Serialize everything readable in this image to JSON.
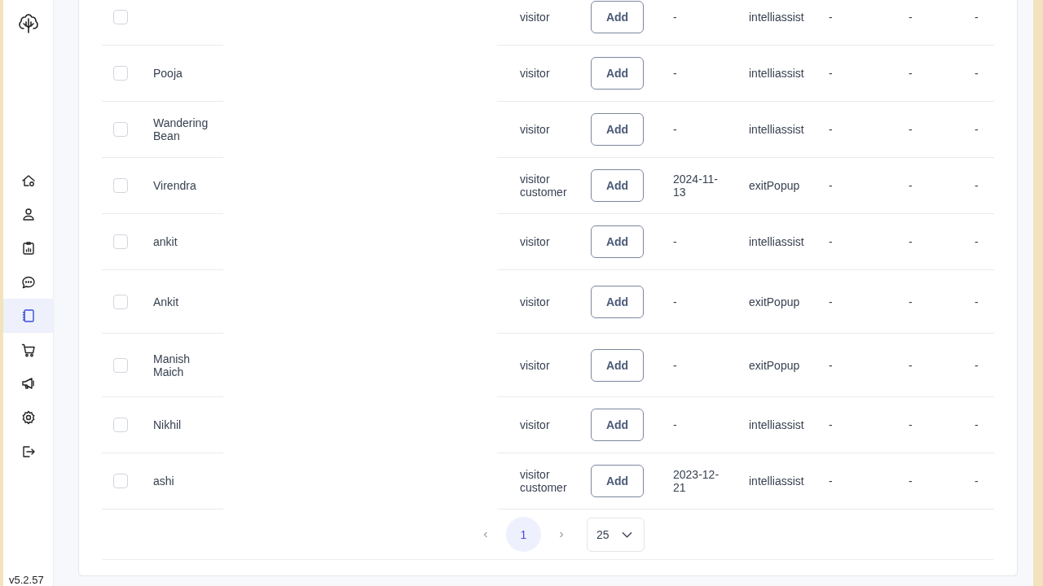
{
  "sidebar": {
    "items": [
      {
        "selected": false
      },
      {
        "selected": false
      },
      {
        "selected": false
      },
      {
        "selected": false
      },
      {
        "selected": true
      },
      {
        "selected": false
      },
      {
        "selected": false
      },
      {
        "selected": false
      },
      {
        "selected": false
      }
    ],
    "version": "v5.2.57"
  },
  "table": {
    "rows": [
      {
        "checked": false,
        "name": "",
        "types": [
          "visitor"
        ],
        "action": "Add",
        "date": "-",
        "source": "intelliassist",
        "column_7": "-",
        "column_8": "-",
        "column_9": "-"
      },
      {
        "checked": false,
        "name": "Pooja",
        "types": [
          "visitor"
        ],
        "action": "Add",
        "date": "-",
        "source": "intelliassist",
        "column_7": "-",
        "column_8": "-",
        "column_9": "-"
      },
      {
        "checked": false,
        "name": "Wandering Bean",
        "types": [
          "visitor"
        ],
        "action": "Add",
        "date": "-",
        "source": "intelliassist",
        "column_7": "-",
        "column_8": "-",
        "column_9": "-"
      },
      {
        "checked": false,
        "name": "Virendra",
        "types": [
          "visitor",
          "customer"
        ],
        "action": "Add",
        "date": "2024-11-13",
        "source": "exitPopup",
        "column_7": "-",
        "column_8": "-",
        "column_9": "-"
      },
      {
        "checked": false,
        "name": "ankit",
        "types": [
          "visitor"
        ],
        "action": "Add",
        "date": "-",
        "source": "intelliassist",
        "column_7": "-",
        "column_8": "-",
        "column_9": "-"
      },
      {
        "checked": false,
        "name": "Ankit",
        "types": [
          "visitor"
        ],
        "action": "Add",
        "date": "-",
        "source": "exitPopup",
        "column_7": "-",
        "column_8": "-",
        "column_9": "-"
      },
      {
        "checked": false,
        "name": "Manish Maich",
        "types": [
          "visitor"
        ],
        "action": "Add",
        "date": "-",
        "source": "exitPopup",
        "column_7": "-",
        "column_8": "-",
        "column_9": "-"
      },
      {
        "checked": false,
        "name": "Nikhil",
        "types": [
          "visitor"
        ],
        "action": "Add",
        "date": "-",
        "source": "intelliassist",
        "column_7": "-",
        "column_8": "-",
        "column_9": "-"
      },
      {
        "checked": false,
        "name": "ashi",
        "types": [
          "visitor",
          "customer"
        ],
        "action": "Add",
        "date": "2023-12-21",
        "source": "intelliassist",
        "column_7": "-",
        "column_8": "-",
        "column_9": "-"
      }
    ]
  },
  "pagination": {
    "pages": [
      {
        "label": "1",
        "selected": true
      }
    ],
    "page_size": "25"
  }
}
